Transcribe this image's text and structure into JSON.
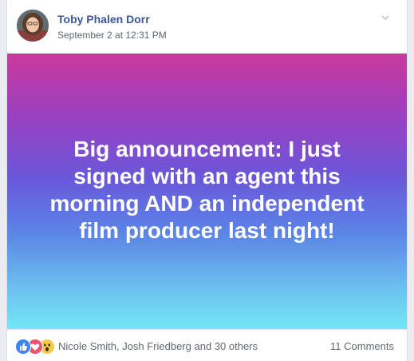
{
  "post": {
    "author": "Toby Phalen Dorr",
    "timestamp": "September 2 at 12:31 PM",
    "text": "Big announcement: I just signed with an agent this morning AND an independent film producer last night!",
    "background_gradient": [
      "#c93a9a",
      "#9b3fc0",
      "#6a57da",
      "#5b84e6",
      "#6bbdef",
      "#74e7f5"
    ]
  },
  "footer": {
    "reactions": [
      "like-icon",
      "love-icon",
      "wow-icon"
    ],
    "reactors": "Nicole Smith, Josh Friedberg and 30 others",
    "comments": "11 Comments"
  },
  "colors": {
    "author_link": "#385898",
    "meta_text": "#606770",
    "like": "#3b86f7",
    "love": "#f0506e",
    "wow": "#f7c948"
  }
}
